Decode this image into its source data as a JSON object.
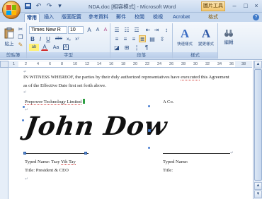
{
  "window": {
    "title": "NDA.doc [相容模式] - Microsoft Word",
    "context_tab_title": "圖片工具",
    "controls": {
      "minimize": "–",
      "maximize": "□",
      "close": "×"
    }
  },
  "qat": {
    "undo": "↶",
    "redo": "↷",
    "more": "▾"
  },
  "tabs": [
    {
      "label": "常用",
      "active": true
    },
    {
      "label": "插入"
    },
    {
      "label": "版面配置"
    },
    {
      "label": "參考資料"
    },
    {
      "label": "郵件"
    },
    {
      "label": "校閱"
    },
    {
      "label": "檢視"
    },
    {
      "label": "Acrobat"
    },
    {
      "label": "格式"
    }
  ],
  "help_label": "?",
  "ribbon": {
    "clipboard": {
      "paste_label": "貼上",
      "group_label": "剪貼簿"
    },
    "font": {
      "font_name": "Times New R",
      "font_size": "10",
      "group_label": "字型",
      "bold": "B",
      "italic": "I",
      "underline": "U",
      "strike": "abe",
      "subscript": "x₂",
      "superscript": "x²",
      "grow": "A",
      "highlight": "ab",
      "font_color": "A",
      "case": "Aa",
      "clear": "A"
    },
    "paragraph": {
      "group_label": "段落"
    },
    "styles": {
      "quick_styles": "快速樣式",
      "change_styles": "變更樣式",
      "group_label": "樣式"
    },
    "editing": {
      "label": "編輯"
    }
  },
  "ruler": {
    "numbers": [
      "1",
      "2",
      "4",
      "6",
      "8",
      "10",
      "12",
      "14",
      "16",
      "18",
      "20",
      "22",
      "24",
      "26",
      "28",
      "30",
      "32",
      "34",
      "36",
      "38"
    ]
  },
  "document": {
    "para1_line1_a": "IN WITNESS WHEREOF, the parties by their duly authorized representatives have ",
    "para1_line1_spell": "exexcuted",
    "para1_line1_b": " this Agreement",
    "para1_line2": "as of the Effective Date first set forth above.",
    "company_left": "Prepower Technology Limited",
    "company_right": "A Co.",
    "signature": "John Dow",
    "typed_name_left_a": "Typed Name: Tsay ",
    "typed_name_left_spell": "Yih Tay",
    "typed_name_right": "Typed Name:",
    "title_left": "Title: President & CEO",
    "title_right": "Title:",
    "pilcrow": "↵"
  },
  "colors": {
    "ribbon_text": "#15428b",
    "accent": "#3c78c8",
    "spell_error": "#d0312d"
  }
}
